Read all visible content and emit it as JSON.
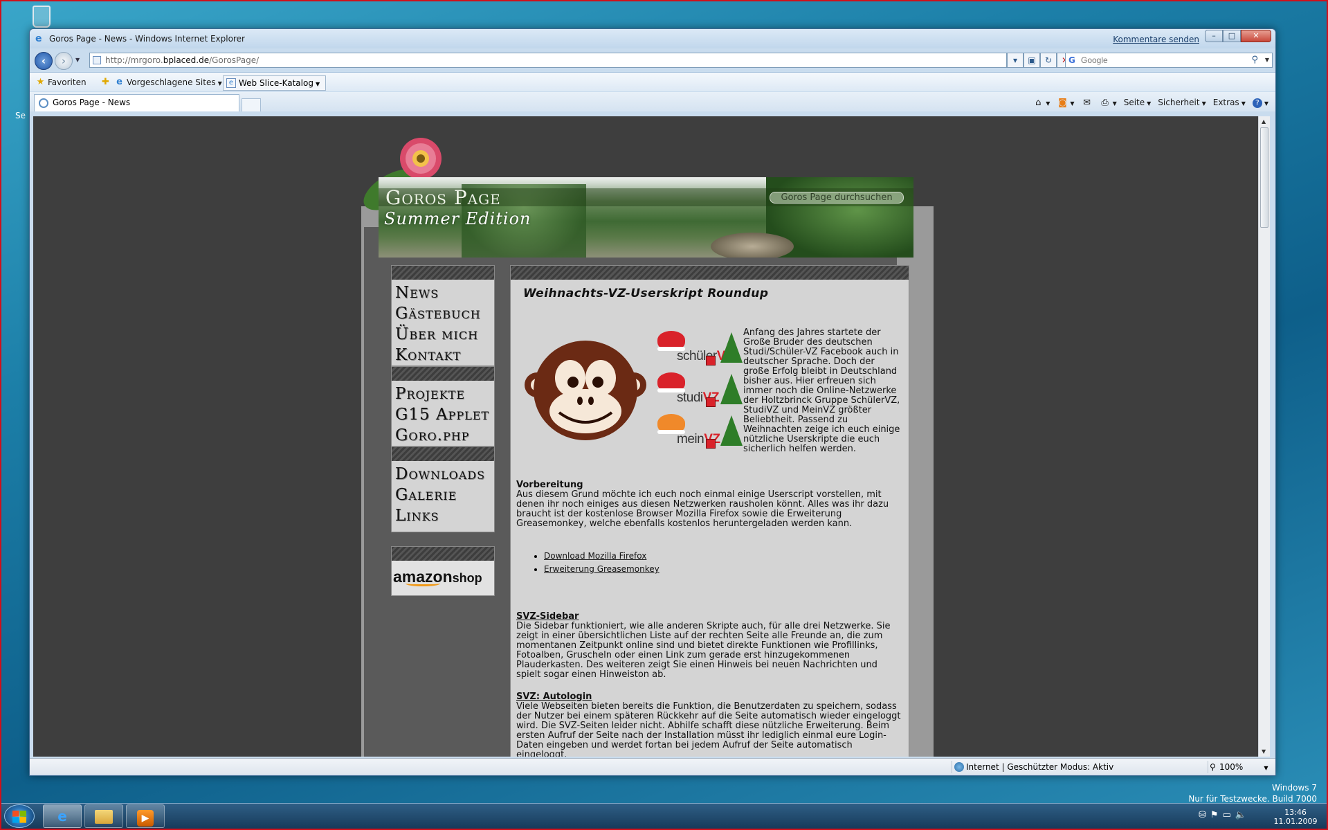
{
  "window": {
    "title": "Goros Page - News - Windows Internet Explorer",
    "feedback_link": "Kommentare senden",
    "buttons": {
      "minimize": "–",
      "maximize": "□",
      "close": "✕"
    }
  },
  "address_bar": {
    "url_prefix": "http://mrgoro.",
    "url_domain": "bplaced.de",
    "url_path": "/GorosPage/"
  },
  "search": {
    "placeholder": "Google",
    "engine_icon": "G"
  },
  "favorites_bar": {
    "favorites": "Favoriten",
    "suggested": "Vorgeschlagene Sites",
    "webslice": "Web Slice-Katalog"
  },
  "tab": {
    "label": "Goros Page - News"
  },
  "command_bar": {
    "page": "Seite",
    "security": "Sicherheit",
    "extras": "Extras"
  },
  "site": {
    "name": "Goros Page",
    "edition": "Summer Edition",
    "search_placeholder": "Goros Page durchsuchen",
    "menu_groups": [
      [
        "News",
        "Gästebuch",
        "Über mich",
        "Kontakt"
      ],
      [
        "Projekte",
        "G15 Applet",
        "Goro.php"
      ],
      [
        "Downloads",
        "Galerie",
        "Links"
      ]
    ],
    "amazon_logo": "amazon",
    "amazon_shop": "shop"
  },
  "post": {
    "title": "Weihnachts-VZ-Userskript Roundup",
    "badges": [
      {
        "name": "schüler",
        "suffix": "VZ"
      },
      {
        "name": "studi",
        "suffix": "VZ"
      },
      {
        "name": "mein",
        "suffix": "VZ"
      }
    ],
    "intro": "Anfang des Jahres startete der Große Bruder des deutschen Studi/Schüler-VZ Facebook auch in deutscher Sprache. Doch der große Erfolg bleibt in Deutschland bisher aus. Hier erfreuen sich immer noch die Online-Netzwerke der Holtzbrinck Gruppe SchülerVZ, StudiVZ und MeinVZ größter Beliebtheit. Passend zu Weihnachten zeige ich euch einige nützliche Userskripte die euch sicherlich helfen werden.",
    "prep_heading": "Vorbereitung",
    "prep_text": "Aus diesem Grund möchte ich euch noch einmal einige Userscript vorstellen, mit denen ihr noch einiges aus diesen Netzwerken rausholen könnt. Alles was ihr dazu braucht ist der kostenlose Browser Mozilla Firefox sowie die Erweiterung Greasemonkey, welche ebenfalls kostenlos heruntergeladen werden kann.",
    "links": [
      "Download Mozilla Firefox",
      "Erweiterung Greasemonkey"
    ],
    "sidebar_heading": "SVZ-Sidebar",
    "sidebar_text": "Die Sidebar funktioniert, wie alle anderen Skripte auch, für alle drei Netzwerke. Sie zeigt in einer übersichtlichen Liste auf der rechten Seite alle Freunde an, die zum momentanen Zeitpunkt online sind und bietet direkte Funktionen wie Profillinks, Fotoalben, Gruscheln oder einen Link zum gerade erst hinzugekommenen Plauderkasten. Des weiteren zeigt Sie einen Hinweis bei neuen Nachrichten und spielt sogar einen Hinweiston ab.",
    "autologin_heading": "SVZ: Autologin",
    "autologin_text": "Viele Webseiten bieten bereits die Funktion, die Benutzerdaten zu speichern, sodass der Nutzer bei einem späteren Rückkehr auf die Seite automatisch wieder eingeloggt wird. Die SVZ-Seiten leider nicht. Abhilfe schafft diese nützliche Erweiterung. Beim ersten Aufruf der Seite nach der Installation müsst ihr lediglich einmal eure Login-Daten eingeben und werdet fortan bei jedem Aufruf der Seite automatisch eingeloggt."
  },
  "status_bar": {
    "zone": "Internet | Geschützter Modus: Aktiv",
    "zoom": "100%"
  },
  "taskbar": {
    "time": "13:46",
    "date": "11.01.2009"
  },
  "watermark": {
    "line1": "Windows 7",
    "line2": "Nur für Testzwecke. Build 7000"
  },
  "desktop": {
    "edge_text": "Se"
  }
}
